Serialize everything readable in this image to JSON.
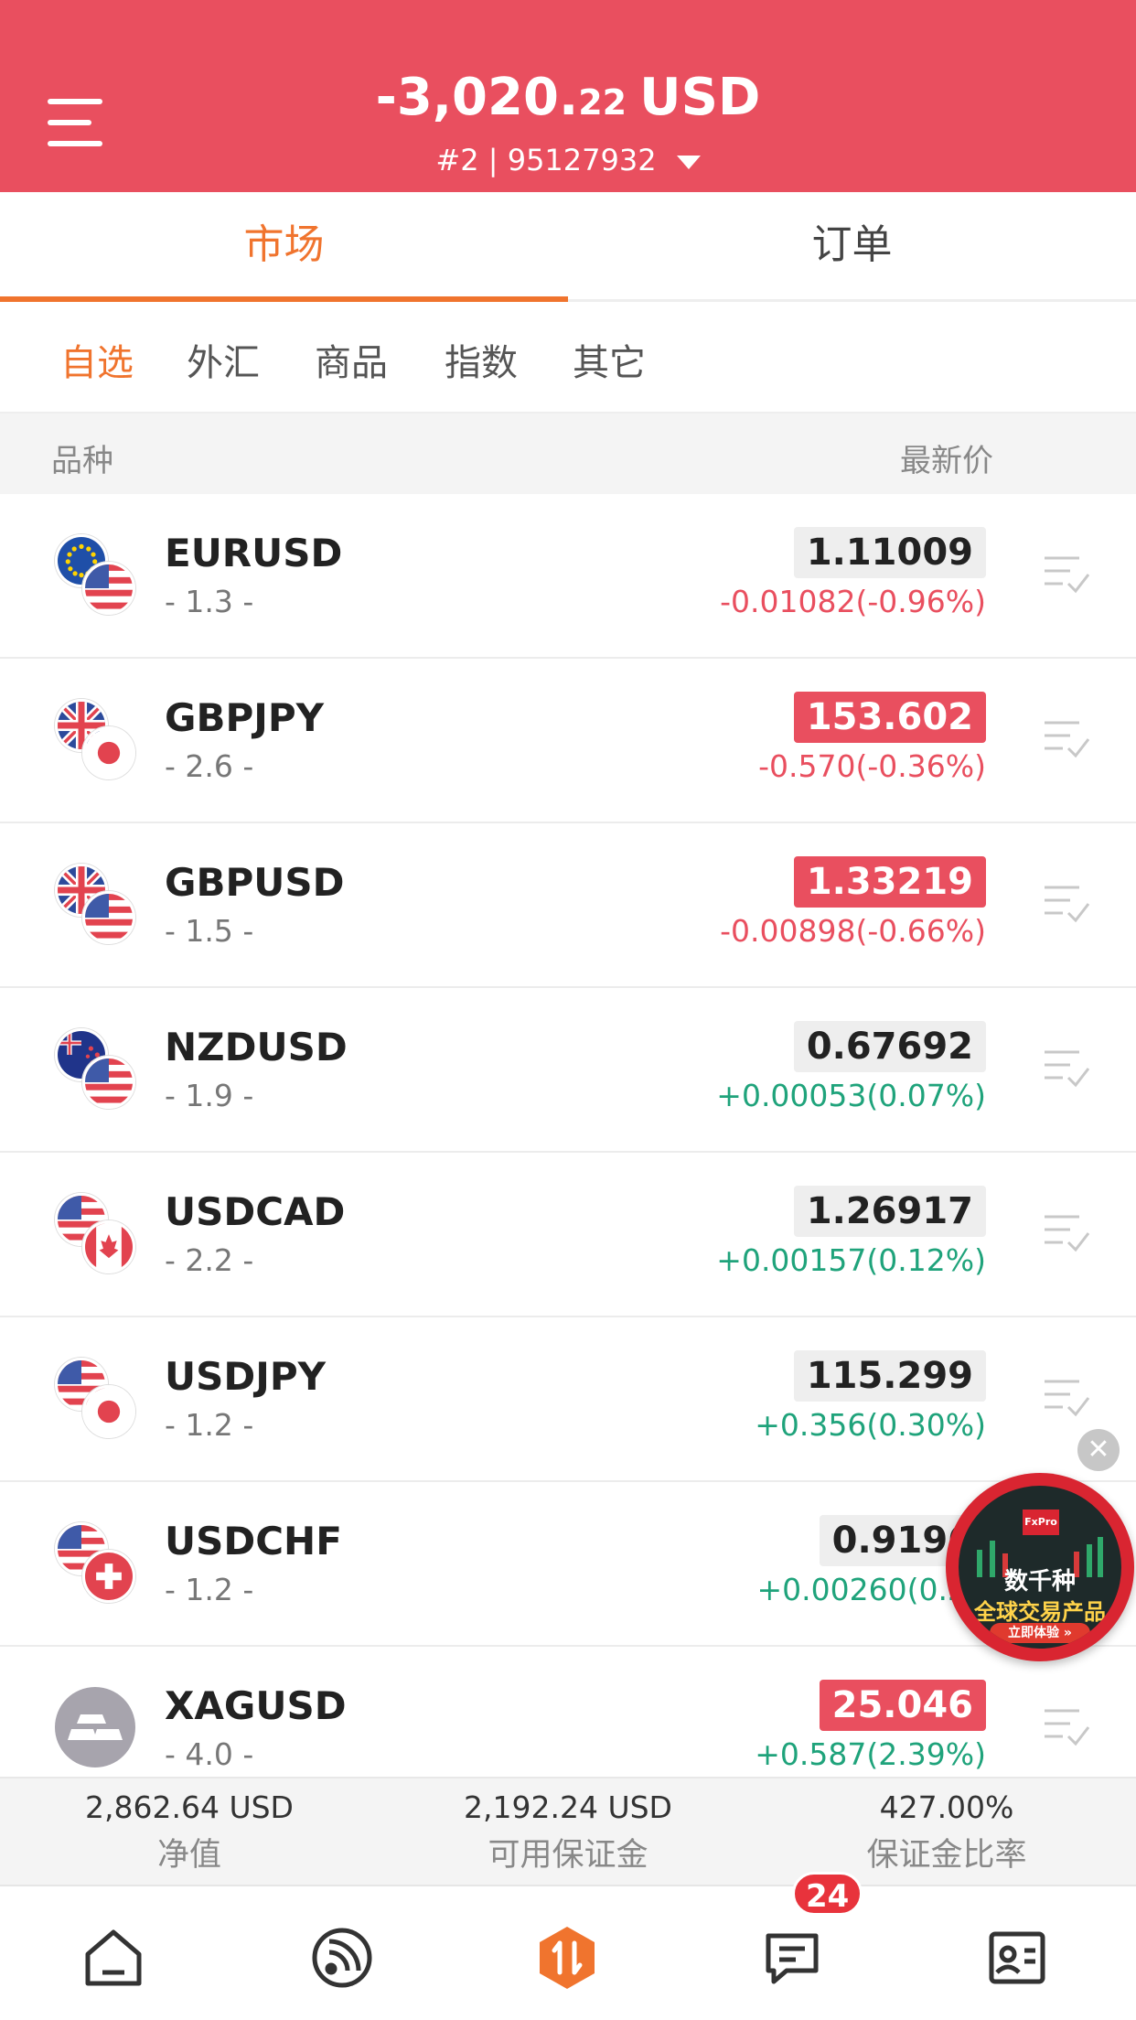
{
  "header": {
    "balance_main": "-3,020.",
    "balance_decimals": "22",
    "balance_currency": "USD",
    "account": "#2 | 95127932",
    "color": "#e94f5f"
  },
  "main_tabs": [
    {
      "label": "市场",
      "active": true
    },
    {
      "label": "订单",
      "active": false
    }
  ],
  "sub_tabs": [
    {
      "label": "自选",
      "active": true
    },
    {
      "label": "外汇",
      "active": false
    },
    {
      "label": "商品",
      "active": false
    },
    {
      "label": "指数",
      "active": false
    },
    {
      "label": "其它",
      "active": false
    }
  ],
  "columns": {
    "left": "品种",
    "right": "最新价"
  },
  "rows": [
    {
      "symbol": "EURUSD",
      "spread": "- 1.3 -",
      "price": "1.11009",
      "change": "-0.01082(-0.96%)",
      "price_state": "neutral",
      "trend": "down"
    },
    {
      "symbol": "GBPJPY",
      "spread": "- 2.6 -",
      "price": "153.602",
      "change": "-0.570(-0.36%)",
      "price_state": "down",
      "trend": "down"
    },
    {
      "symbol": "GBPUSD",
      "spread": "- 1.5 -",
      "price": "1.33219",
      "change": "-0.00898(-0.66%)",
      "price_state": "down",
      "trend": "down"
    },
    {
      "symbol": "NZDUSD",
      "spread": "- 1.9 -",
      "price": "0.67692",
      "change": "+0.00053(0.07%)",
      "price_state": "neutral",
      "trend": "up"
    },
    {
      "symbol": "USDCAD",
      "spread": "- 2.2 -",
      "price": "1.26917",
      "change": "+0.00157(0.12%)",
      "price_state": "neutral",
      "trend": "up"
    },
    {
      "symbol": "USDJPY",
      "spread": "- 1.2 -",
      "price": "115.299",
      "change": "+0.356(0.30%)",
      "price_state": "neutral",
      "trend": "up"
    },
    {
      "symbol": "USDCHF",
      "spread": "- 1.2 -",
      "price": "0.9196",
      "change": "+0.00260(0.28",
      "price_state": "neutral",
      "trend": "up"
    },
    {
      "symbol": "XAGUSD",
      "spread": "- 4.0 -",
      "price": "25.046",
      "change": "+0.587(2.39%)",
      "price_state": "down",
      "trend": "up"
    }
  ],
  "promo": {
    "logo": "FxPro",
    "line1": "数千种",
    "line2": "全球交易产品",
    "cta": "立即体验 »"
  },
  "summary": [
    {
      "value": "2,862.64 USD",
      "label": "净值"
    },
    {
      "value": "2,192.24 USD",
      "label": "可用保证金"
    },
    {
      "value": "427.00%",
      "label": "保证金比率"
    }
  ],
  "nav": {
    "items": [
      "home-icon",
      "news-feed-icon",
      "trade-icon",
      "messages-icon",
      "profile-card-icon"
    ],
    "messages_badge": "24"
  },
  "colors": {
    "accent": "#f0742e",
    "down": "#e94f5f",
    "up": "#1fa37b"
  }
}
